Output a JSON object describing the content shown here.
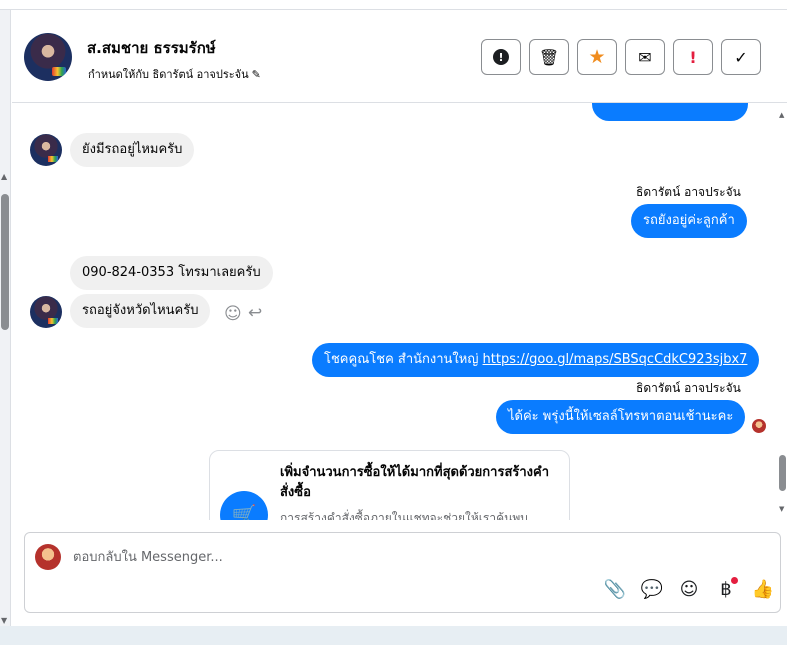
{
  "header": {
    "contact_name": "ส.สมชาย ธรรมรักษ์",
    "assigned_to": "กำหนดให้กับ ธิดารัตน์ อาจประจัน",
    "actions": [
      {
        "name": "spam",
        "glyph": "!"
      },
      {
        "name": "trash",
        "glyph": "🗑"
      },
      {
        "name": "star",
        "glyph": "★"
      },
      {
        "name": "mail",
        "glyph": "✉"
      },
      {
        "name": "important",
        "glyph": "!"
      },
      {
        "name": "done",
        "glyph": "✓"
      }
    ]
  },
  "messages": [
    {
      "from": "customer",
      "text": "ยังมีรถอยู่ไหมครับ"
    },
    {
      "from": "agent",
      "sender": "ธิดารัตน์ อาจประจัน",
      "text": "รถยังอยู่ค่ะลูกค้า"
    },
    {
      "from": "customer",
      "text": "090-824-0353 โทรมาเลยครับ"
    },
    {
      "from": "customer",
      "text": "รถอยู่จังหวัดไหนครับ"
    },
    {
      "from": "agent",
      "text_prefix": "โชคคูณโชค สำนักงานใหญ่ ",
      "link": "https://goo.gl/maps/SBSqcCdkC923sjbx7"
    },
    {
      "from": "agent",
      "sender": "ธิดารัตน์ อาจประจัน",
      "text": "ได้ค่ะ พรุ่งนี้ให้เซลล์โทรหาตอนเช้านะคะ"
    }
  ],
  "card": {
    "title": "เพิ่มจำนวนการซื้อให้ได้มากที่สุดด้วยการสร้างคำสั่งซื้อ",
    "subtitle": "การสร้างคำสั่งซื้อภายในแชทจะช่วยให้เราค้นพบ"
  },
  "composer": {
    "placeholder": "ตอบกลับใน Messenger..."
  },
  "icons": {
    "attach": "attach-icon",
    "chat": "speech-bubble-icon",
    "emoji": "emoji-icon",
    "baht": "baht-icon",
    "like": "thumbs-up-icon"
  }
}
